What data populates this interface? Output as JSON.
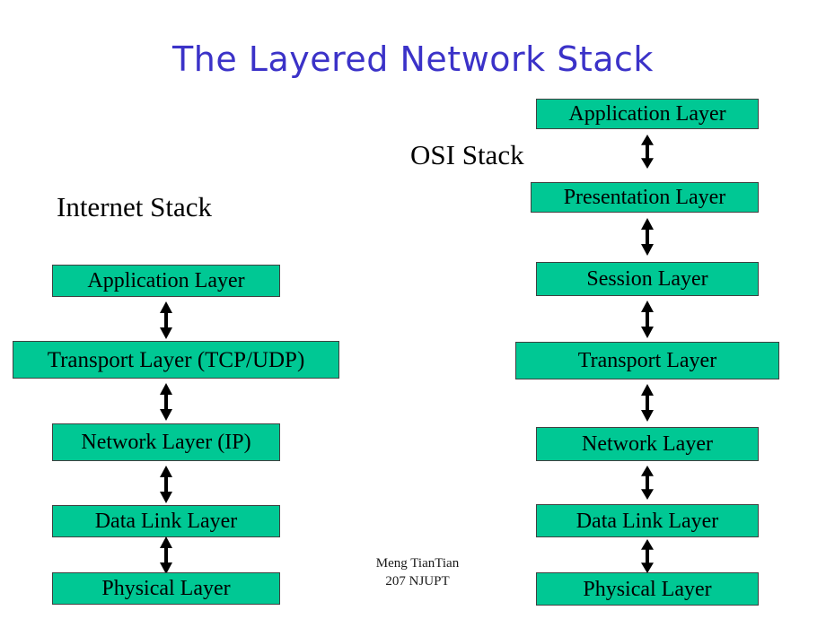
{
  "slide": {
    "title": "The Layered Network Stack",
    "title_color": "#3b32c8",
    "background_color": "#ffffff",
    "box_fill_color": "#00c894",
    "box_border_color": "#404040",
    "text_color": "#000000"
  },
  "internet_stack": {
    "caption": "Internet Stack",
    "layers": [
      {
        "label": "Application Layer"
      },
      {
        "label": "Transport Layer (TCP/UDP)"
      },
      {
        "label": "Network Layer (IP)"
      },
      {
        "label": "Data Link Layer"
      },
      {
        "label": "Physical Layer"
      }
    ],
    "connector_icon": "double-headed-vertical-arrow",
    "connector_count": 4
  },
  "osi_stack": {
    "caption": "OSI Stack",
    "layers": [
      {
        "label": "Application Layer"
      },
      {
        "label": "Presentation Layer"
      },
      {
        "label": "Session Layer"
      },
      {
        "label": "Transport Layer"
      },
      {
        "label": "Network Layer"
      },
      {
        "label": "Data Link Layer"
      },
      {
        "label": "Physical Layer"
      }
    ],
    "connector_icon": "double-headed-vertical-arrow",
    "connector_count": 6
  },
  "credit": {
    "line1": "Meng TianTian",
    "line2": "207 NJUPT"
  }
}
